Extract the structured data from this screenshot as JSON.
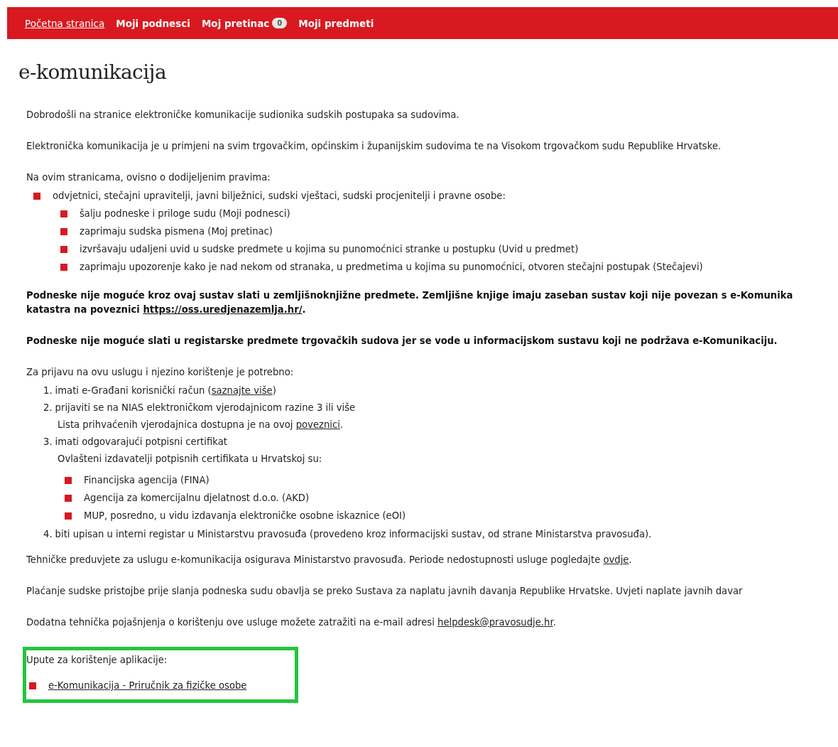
{
  "nav": {
    "items": [
      {
        "label": "Početna stranica",
        "selected": true
      },
      {
        "label": "Moji podnesci",
        "selected": false
      },
      {
        "label": "Moj pretinac",
        "selected": false,
        "badge": "0"
      },
      {
        "label": "Moji predmeti",
        "selected": false
      }
    ]
  },
  "title": "e-komunikacija",
  "blocks": [
    {
      "kind": "paragraph",
      "bold": false,
      "parts": [
        {
          "kind": "text",
          "text": "Dobrodošli na stranice elektroničke komunikacije sudionika sudskih postupaka sa sudovima."
        }
      ]
    },
    {
      "kind": "paragraph",
      "bold": false,
      "parts": [
        {
          "kind": "text",
          "text": "Elektronička komunikacija je u primjeni na svim trgovačkim, općinskim i županijskim sudovima te na Visokom trgovačkom sudu Republike Hrvatske."
        }
      ]
    },
    {
      "kind": "paragraph",
      "bold": false,
      "parts": [
        {
          "kind": "text",
          "text": "Na ovim stranicama, ovisno o dodijeljenim pravima:"
        }
      ]
    },
    {
      "kind": "bullets",
      "items": [
        {
          "text": "odvjetnici, stečajni upravitelji, javni bilježnici, sudski vještaci, sudski procjenitelji i pravne osobe:",
          "children": [
            {
              "text": "šalju podneske i priloge sudu (Moji podnesci)"
            },
            {
              "text": "zaprimaju sudska pismena (Moj pretinac)"
            },
            {
              "text": "izvršavaju udaljeni uvid u sudske predmete u kojima su punomoćnici stranke u postupku (Uvid u predmet)"
            },
            {
              "text": "zaprimaju upozorenje kako je nad nekom od stranaka, u predmetima u kojima su punomoćnici, otvoren stečajni postupak (Stečajevi)"
            }
          ]
        }
      ]
    },
    {
      "kind": "paragraph",
      "bold": true,
      "parts": [
        {
          "kind": "text",
          "text": "Podneske nije moguće kroz ovaj sustav slati u zemljišnoknjižne predmete. Zemljišne knjige imaju zaseban sustav koji nije povezan s e-Komunika"
        },
        {
          "kind": "break"
        },
        {
          "kind": "text",
          "text": "katastra na poveznici "
        },
        {
          "kind": "link",
          "text": "https://oss.uredjenazemlja.hr/"
        },
        {
          "kind": "text",
          "text": "."
        }
      ]
    },
    {
      "kind": "paragraph",
      "bold": true,
      "parts": [
        {
          "kind": "text",
          "text": "Podneske nije moguće slati u registarske predmete trgovačkih sudova jer se vode u informacijskom sustavu koji ne podržava e-Komunikaciju."
        }
      ]
    },
    {
      "kind": "paragraph",
      "bold": false,
      "parts": [
        {
          "kind": "text",
          "text": "Za prijavu na ovu uslugu i njezino korištenje je potrebno:"
        }
      ]
    },
    {
      "kind": "ordered",
      "items": [
        {
          "number": "1.",
          "parts": [
            {
              "kind": "text",
              "text": "imati e-Građani korisnički račun ("
            },
            {
              "kind": "link",
              "text": "saznajte više"
            },
            {
              "kind": "text",
              "text": ")"
            }
          ]
        },
        {
          "number": "2.",
          "parts": [
            {
              "kind": "text",
              "text": "prijaviti se na NIAS elektroničkom vjerodajnicom razine 3 ili više"
            }
          ],
          "note": [
            {
              "kind": "text",
              "text": "Lista prihvaćenih vjerodajnica dostupna je na ovoj "
            },
            {
              "kind": "link",
              "text": "poveznici"
            },
            {
              "kind": "text",
              "text": "."
            }
          ]
        },
        {
          "number": "3.",
          "parts": [
            {
              "kind": "text",
              "text": "imati odgovarajući potpisni certifikat"
            }
          ],
          "note": [
            {
              "kind": "text",
              "text": "Ovlašteni izdavatelji potpisnih certifikata u Hrvatskoj su:"
            }
          ],
          "children": [
            {
              "text": "Financijska agencija (FINA)"
            },
            {
              "text": "Agencija za komercijalnu djelatnost d.o.o. (AKD)"
            },
            {
              "text": "MUP, posredno, u vidu izdavanja elektroničke osobne iskaznice (eOI)"
            }
          ]
        },
        {
          "number": "4.",
          "parts": [
            {
              "kind": "text",
              "text": "biti upisan u interni registar u Ministarstvu pravosuđa (provedeno kroz informacijski sustav, od strane Ministarstva pravosuđa)."
            }
          ]
        }
      ]
    },
    {
      "kind": "paragraph",
      "bold": false,
      "parts": [
        {
          "kind": "text",
          "text": "Tehničke preduvjete za uslugu e-komunikacija osigurava Ministarstvo pravosuđa. Periode nedostupnosti usluge pogledajte "
        },
        {
          "kind": "link",
          "text": "ovdje"
        },
        {
          "kind": "text",
          "text": "."
        }
      ]
    },
    {
      "kind": "paragraph",
      "bold": false,
      "parts": [
        {
          "kind": "text",
          "text": "Plaćanje sudske pristojbe prije slanja podneska sudu obavlja se preko Sustava za naplatu javnih davanja Republike Hrvatske. Uvjeti naplate javnih davar"
        }
      ]
    },
    {
      "kind": "paragraph",
      "bold": false,
      "parts": [
        {
          "kind": "text",
          "text": "Dodatna tehnička pojašnjenja o korištenju ove usluge možete zatražiti na e-mail adresi "
        },
        {
          "kind": "link",
          "text": "helpdesk@pravosudje.hr"
        },
        {
          "kind": "text",
          "text": "."
        }
      ]
    },
    {
      "kind": "highlight",
      "blocks": [
        {
          "kind": "paragraph",
          "bold": false,
          "parts": [
            {
              "kind": "text",
              "text": "Upute za korištenje aplikacije:"
            }
          ]
        },
        {
          "kind": "links",
          "items": [
            {
              "text": "e-Komunikacija - Priručnik za fizičke osobe"
            }
          ]
        }
      ]
    }
  ]
}
